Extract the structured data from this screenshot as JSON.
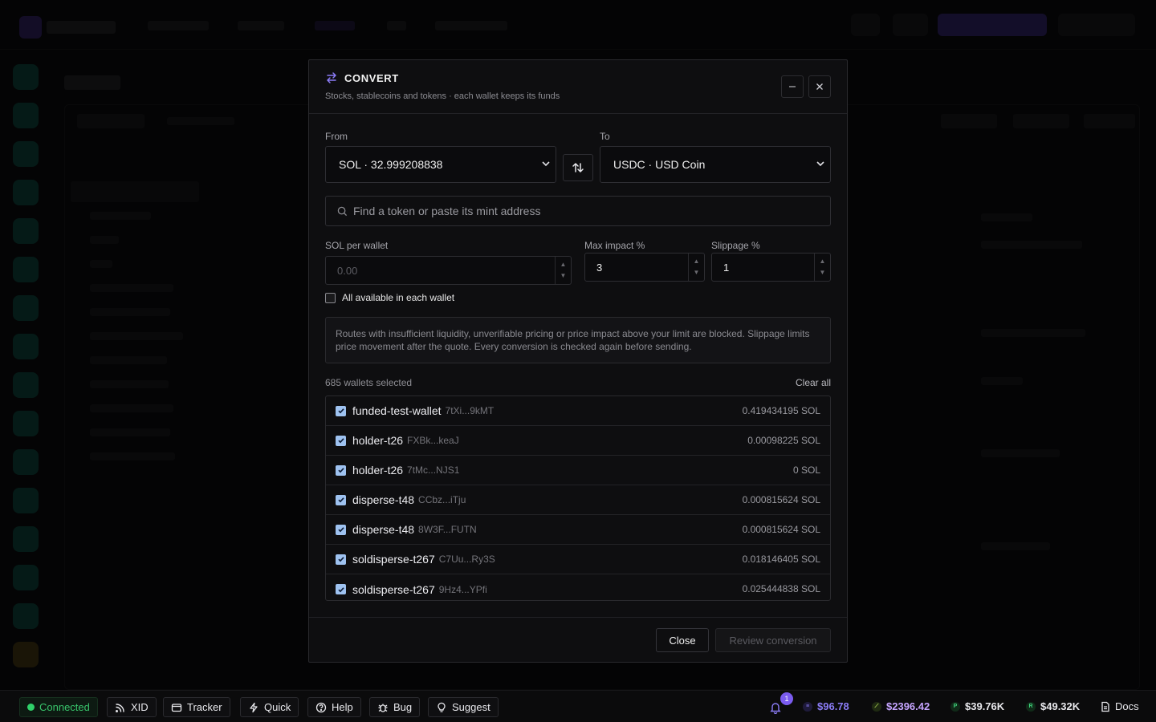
{
  "modal": {
    "title": "CONVERT",
    "subtitle": "Stocks, stablecoins and tokens · each wallet keeps its funds",
    "from_label": "From",
    "from_value": "SOL · 32.999208838",
    "to_label": "To",
    "to_value": "USDC · USD Coin",
    "search_placeholder": "Find a token or paste its mint address",
    "sol_per_wallet_label": "SOL per wallet",
    "sol_per_wallet_placeholder": "0.00",
    "max_impact_label": "Max impact %",
    "max_impact_value": "3",
    "slippage_label": "Slippage %",
    "slippage_value": "1",
    "all_available_label": "All available in each wallet",
    "all_available_checked": false,
    "notice": "Routes with insufficient liquidity, unverifiable pricing or price impact above your limit are blocked. Slippage limits price movement after the quote. Every conversion is checked again before sending.",
    "selected_count": "685 wallets selected",
    "clear_all": "Clear all",
    "wallets": [
      {
        "name": "funded-test-wallet",
        "address": "7tXi...9kMT",
        "balance": "0.419434195 SOL",
        "checked": true
      },
      {
        "name": "holder-t26",
        "address": "FXBk...keaJ",
        "balance": "0.00098225 SOL",
        "checked": true
      },
      {
        "name": "holder-t26",
        "address": "7tMc...NJS1",
        "balance": "0 SOL",
        "checked": true
      },
      {
        "name": "disperse-t48",
        "address": "CCbz...iTju",
        "balance": "0.000815624 SOL",
        "checked": true
      },
      {
        "name": "disperse-t48",
        "address": "8W3F...FUTN",
        "balance": "0.000815624 SOL",
        "checked": true
      },
      {
        "name": "soldisperse-t267",
        "address": "C7Uu...Ry3S",
        "balance": "0.018146405 SOL",
        "checked": true
      },
      {
        "name": "soldisperse-t267",
        "address": "9Hz4...YPfi",
        "balance": "0.025444838 SOL",
        "checked": true
      }
    ],
    "close_label": "Close",
    "review_label": "Review conversion"
  },
  "statusbar": {
    "connected": "Connected",
    "xid": "XID",
    "tracker": "Tracker",
    "quick": "Quick",
    "help": "Help",
    "bug": "Bug",
    "suggest": "Suggest",
    "notification_count": "1",
    "prices": [
      {
        "icon": "sol-icon",
        "value": "$96.78",
        "color": "#8b7cf6"
      },
      {
        "icon": "eth-icon",
        "value": "$2396.42",
        "color": "#c6a5ff"
      },
      {
        "icon": "p-token-icon",
        "value": "$39.76K",
        "color": "#e8e8ec"
      },
      {
        "icon": "r-token-icon",
        "value": "$49.32K",
        "color": "#e8e8ec"
      }
    ],
    "docs": "Docs"
  },
  "colors": {
    "accent": "#7b5cf0",
    "success": "#2fd26a",
    "checkbox": "#9ec2f0"
  }
}
